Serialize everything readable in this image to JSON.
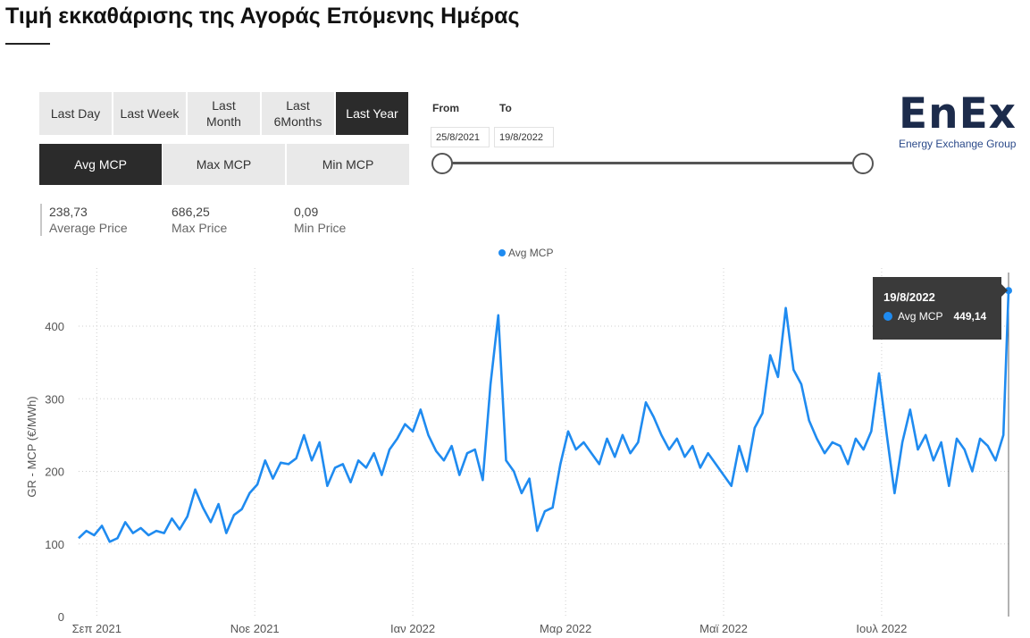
{
  "header": {
    "title": "Τιμή εκκαθάρισης της Αγοράς Επόμενης Ημέρας"
  },
  "period_buttons": [
    {
      "label": "Last Day",
      "active": false
    },
    {
      "label": "Last Week",
      "active": false
    },
    {
      "label": "Last\nMonth",
      "active": false
    },
    {
      "label": "Last\n6Months",
      "active": false
    },
    {
      "label": "Last Year",
      "active": true
    }
  ],
  "metric_buttons": [
    {
      "label": "Avg MCP",
      "active": true
    },
    {
      "label": "Max MCP",
      "active": false
    },
    {
      "label": "Min MCP",
      "active": false
    }
  ],
  "kpis": [
    {
      "value": "238,73",
      "label": "Average Price"
    },
    {
      "value": "686,25",
      "label": "Max Price"
    },
    {
      "value": "0,09",
      "label": "Min Price"
    }
  ],
  "date_range": {
    "from_label": "From",
    "to_label": "To",
    "from_value": "25/8/2021",
    "to_value": "19/8/2022"
  },
  "logo": {
    "word": "EnEx",
    "subtitle": "Energy Exchange Group"
  },
  "tooltip": {
    "date": "19/8/2022",
    "series": "Avg MCP",
    "value": "449,14"
  },
  "colors": {
    "accent": "#1f8bf0",
    "active_button": "#2b2b2b",
    "button": "#e9e9e9"
  },
  "chart_data": {
    "type": "line",
    "title": "",
    "xlabel": "",
    "ylabel": "GR - MCP (€/MWh)",
    "ylim": [
      0,
      470
    ],
    "yticks": [
      0,
      100,
      200,
      300,
      400
    ],
    "legend": "top-center",
    "grid": true,
    "x_ticks": [
      "Σεπ 2021",
      "Νοε 2021",
      "Ιαν 2022",
      "Μαρ 2022",
      "Μαϊ 2022",
      "Ιουλ 2022"
    ],
    "x_tick_dates": [
      "2021-09-01",
      "2021-11-01",
      "2022-01-01",
      "2022-03-01",
      "2022-05-01",
      "2022-07-01"
    ],
    "x_range": [
      "2021-08-25",
      "2022-08-19"
    ],
    "series": [
      {
        "name": "Avg MCP",
        "points": [
          [
            "2021-08-25",
            108
          ],
          [
            "2021-08-28",
            118
          ],
          [
            "2021-08-31",
            112
          ],
          [
            "2021-09-03",
            125
          ],
          [
            "2021-09-06",
            103
          ],
          [
            "2021-09-09",
            108
          ],
          [
            "2021-09-12",
            130
          ],
          [
            "2021-09-15",
            115
          ],
          [
            "2021-09-18",
            122
          ],
          [
            "2021-09-21",
            112
          ],
          [
            "2021-09-24",
            118
          ],
          [
            "2021-09-27",
            115
          ],
          [
            "2021-09-30",
            135
          ],
          [
            "2021-10-03",
            120
          ],
          [
            "2021-10-06",
            138
          ],
          [
            "2021-10-09",
            175
          ],
          [
            "2021-10-12",
            150
          ],
          [
            "2021-10-15",
            130
          ],
          [
            "2021-10-18",
            155
          ],
          [
            "2021-10-21",
            115
          ],
          [
            "2021-10-24",
            140
          ],
          [
            "2021-10-27",
            148
          ],
          [
            "2021-10-30",
            170
          ],
          [
            "2021-11-02",
            182
          ],
          [
            "2021-11-05",
            215
          ],
          [
            "2021-11-08",
            190
          ],
          [
            "2021-11-11",
            212
          ],
          [
            "2021-11-14",
            210
          ],
          [
            "2021-11-17",
            218
          ],
          [
            "2021-11-20",
            250
          ],
          [
            "2021-11-23",
            215
          ],
          [
            "2021-11-26",
            240
          ],
          [
            "2021-11-29",
            180
          ],
          [
            "2021-12-02",
            205
          ],
          [
            "2021-12-05",
            210
          ],
          [
            "2021-12-08",
            185
          ],
          [
            "2021-12-11",
            215
          ],
          [
            "2021-12-14",
            205
          ],
          [
            "2021-12-17",
            225
          ],
          [
            "2021-12-20",
            195
          ],
          [
            "2021-12-23",
            230
          ],
          [
            "2021-12-26",
            245
          ],
          [
            "2021-12-29",
            265
          ],
          [
            "2022-01-01",
            255
          ],
          [
            "2022-01-04",
            285
          ],
          [
            "2022-01-07",
            250
          ],
          [
            "2022-01-10",
            228
          ],
          [
            "2022-01-13",
            215
          ],
          [
            "2022-01-16",
            235
          ],
          [
            "2022-01-19",
            195
          ],
          [
            "2022-01-22",
            225
          ],
          [
            "2022-01-25",
            230
          ],
          [
            "2022-01-28",
            188
          ],
          [
            "2022-01-31",
            320
          ],
          [
            "2022-02-03",
            415
          ],
          [
            "2022-02-06",
            215
          ],
          [
            "2022-02-09",
            200
          ],
          [
            "2022-02-12",
            170
          ],
          [
            "2022-02-15",
            190
          ],
          [
            "2022-02-18",
            118
          ],
          [
            "2022-02-21",
            145
          ],
          [
            "2022-02-24",
            150
          ],
          [
            "2022-02-27",
            210
          ],
          [
            "2022-03-02",
            255
          ],
          [
            "2022-03-05",
            230
          ],
          [
            "2022-03-08",
            240
          ],
          [
            "2022-03-11",
            225
          ],
          [
            "2022-03-14",
            210
          ],
          [
            "2022-03-17",
            245
          ],
          [
            "2022-03-20",
            220
          ],
          [
            "2022-03-23",
            250
          ],
          [
            "2022-03-26",
            225
          ],
          [
            "2022-03-29",
            240
          ],
          [
            "2022-04-01",
            295
          ],
          [
            "2022-04-04",
            275
          ],
          [
            "2022-04-07",
            250
          ],
          [
            "2022-04-10",
            230
          ],
          [
            "2022-04-13",
            245
          ],
          [
            "2022-04-16",
            220
          ],
          [
            "2022-04-19",
            235
          ],
          [
            "2022-04-22",
            205
          ],
          [
            "2022-04-25",
            225
          ],
          [
            "2022-04-28",
            210
          ],
          [
            "2022-05-01",
            195
          ],
          [
            "2022-05-04",
            180
          ],
          [
            "2022-05-07",
            235
          ],
          [
            "2022-05-10",
            200
          ],
          [
            "2022-05-13",
            260
          ],
          [
            "2022-05-16",
            280
          ],
          [
            "2022-05-19",
            360
          ],
          [
            "2022-05-22",
            330
          ],
          [
            "2022-05-25",
            425
          ],
          [
            "2022-05-28",
            340
          ],
          [
            "2022-05-31",
            320
          ],
          [
            "2022-06-03",
            270
          ],
          [
            "2022-06-06",
            245
          ],
          [
            "2022-06-09",
            225
          ],
          [
            "2022-06-12",
            240
          ],
          [
            "2022-06-15",
            235
          ],
          [
            "2022-06-18",
            210
          ],
          [
            "2022-06-21",
            245
          ],
          [
            "2022-06-24",
            230
          ],
          [
            "2022-06-27",
            255
          ],
          [
            "2022-06-30",
            335
          ],
          [
            "2022-07-03",
            250
          ],
          [
            "2022-07-06",
            170
          ],
          [
            "2022-07-09",
            240
          ],
          [
            "2022-07-12",
            285
          ],
          [
            "2022-07-15",
            230
          ],
          [
            "2022-07-18",
            250
          ],
          [
            "2022-07-21",
            215
          ],
          [
            "2022-07-24",
            240
          ],
          [
            "2022-07-27",
            180
          ],
          [
            "2022-07-30",
            245
          ],
          [
            "2022-08-02",
            230
          ],
          [
            "2022-08-05",
            200
          ],
          [
            "2022-08-08",
            245
          ],
          [
            "2022-08-11",
            235
          ],
          [
            "2022-08-14",
            215
          ],
          [
            "2022-08-17",
            250
          ],
          [
            "2022-08-19",
            449
          ]
        ]
      }
    ]
  }
}
